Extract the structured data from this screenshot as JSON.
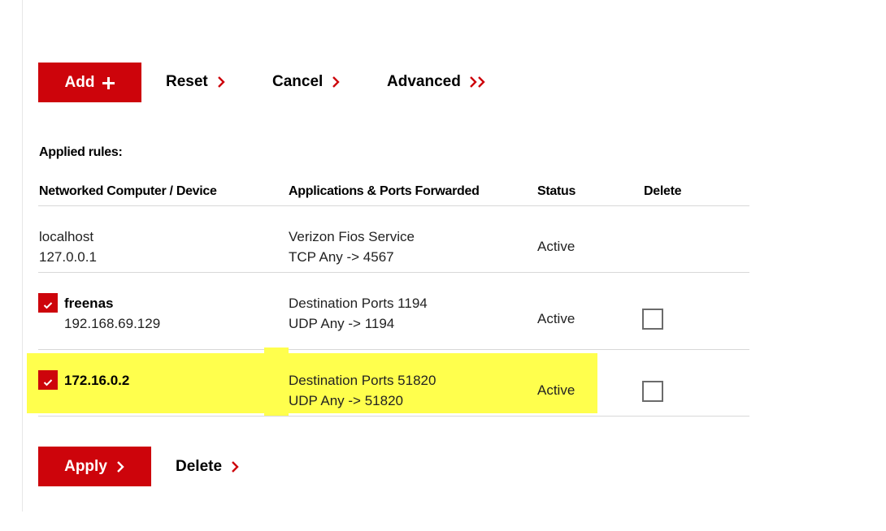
{
  "actions": {
    "add_label": "Add",
    "reset_label": "Reset",
    "cancel_label": "Cancel",
    "advanced_label": "Advanced"
  },
  "applied_rules": {
    "heading": "Applied rules:",
    "columns": {
      "device": "Networked Computer / Device",
      "apps": "Applications & Ports Forwarded",
      "status": "Status",
      "delete": "Delete"
    },
    "rows": [
      {
        "device_name": "localhost",
        "device_ip": "127.0.0.1",
        "app_line1": "Verizon Fios Service",
        "app_line2": "TCP Any -> 4567",
        "status": "Active",
        "enabled": null,
        "deletable": false
      },
      {
        "device_name": "freenas",
        "device_ip": "192.168.69.129",
        "app_line1": "Destination Ports 1194",
        "app_line2": "UDP Any -> 1194",
        "status": "Active",
        "enabled": true,
        "deletable": true
      },
      {
        "device_name": "172.16.0.2",
        "device_ip": "",
        "app_line1": "Destination Ports 51820",
        "app_line2": "UDP Any -> 51820",
        "status": "Active",
        "enabled": true,
        "deletable": true,
        "highlighted": true
      }
    ]
  },
  "footer_actions": {
    "apply_label": "Apply",
    "delete_label": "Delete"
  },
  "colors": {
    "brand_red": "#cd040b",
    "highlight_yellow": "#ffff4d"
  },
  "icons": {
    "add": "plus-icon",
    "chevron": "chevron-right-icon",
    "double_chevron": "double-chevron-right-icon",
    "checked": "checkmark-icon"
  }
}
